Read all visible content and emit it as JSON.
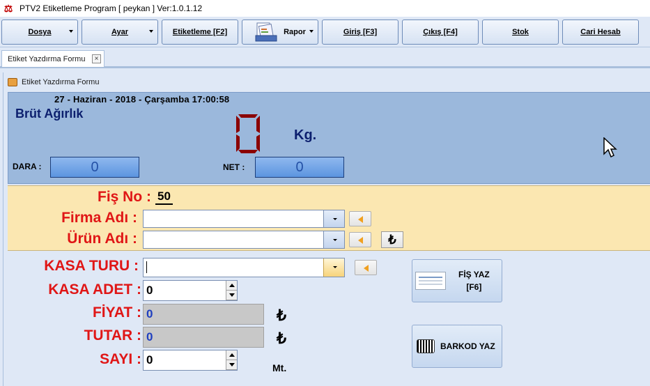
{
  "window": {
    "title": "PTV2  Etiketleme Program   [ peykan ]   Ver:1.0.1.12"
  },
  "menu": [
    {
      "label": "Dosya",
      "dropdown": true
    },
    {
      "label": "Ayar",
      "dropdown": true
    },
    {
      "label": "Etiketleme [F2]",
      "dropdown": false
    },
    {
      "label": "Rapor",
      "dropdown": true
    },
    {
      "label": "Giriş [F3]",
      "dropdown": false
    },
    {
      "label": "Çıkış [F4]",
      "dropdown": false
    },
    {
      "label": "Stok",
      "dropdown": false
    },
    {
      "label": "Cari Hesab",
      "dropdown": false
    }
  ],
  "tab": {
    "label": "Etiket Yazdırma Formu",
    "close": "×"
  },
  "form": {
    "title": "Etiket Yazdırma Formu",
    "date": "27  -  Haziran - 2018  -  Çarşamba      17:00:58",
    "brut_label": "Brüt Ağırlık",
    "weight_digit": "0",
    "kg_label": "Kg.",
    "dara_label": "DARA :",
    "dara_value": "0",
    "net_label": "NET :",
    "net_value": "0",
    "fis_label": "Fiş No :",
    "fis_value": "50",
    "firma_label": "Firma Adı :",
    "firma_value": "",
    "urun_label": "Ürün Adı :",
    "urun_value": "",
    "currency_symbol": "₺",
    "kasa_turu_label": "KASA TURU :",
    "kasa_turu_value": "",
    "kasa_adet_label": "KASA ADET :",
    "kasa_adet_value": "0",
    "fiyat_label": "FİYAT :",
    "fiyat_value": "0",
    "tutar_label": "TUTAR :",
    "tutar_value": "0",
    "sayi_label": "SAYI :",
    "sayi_value": "0",
    "unit_mt": "Mt.",
    "fis_yaz_label": "FİŞ YAZ",
    "fis_yaz_key": "[F6]",
    "barkod_label": "BARKOD YAZ"
  },
  "colors": {
    "accent_red": "#e01616",
    "label_blue": "#0c1f6e",
    "digit_red": "#8b0000",
    "weigh_panel": "#9bb8dc",
    "yellow_panel": "#fbe7b1"
  },
  "icons": [
    "scales-icon",
    "rapor-icon",
    "close-icon",
    "form-icon",
    "back-arrow-icon",
    "lira-icon",
    "receipt-icon",
    "barcode-icon"
  ]
}
